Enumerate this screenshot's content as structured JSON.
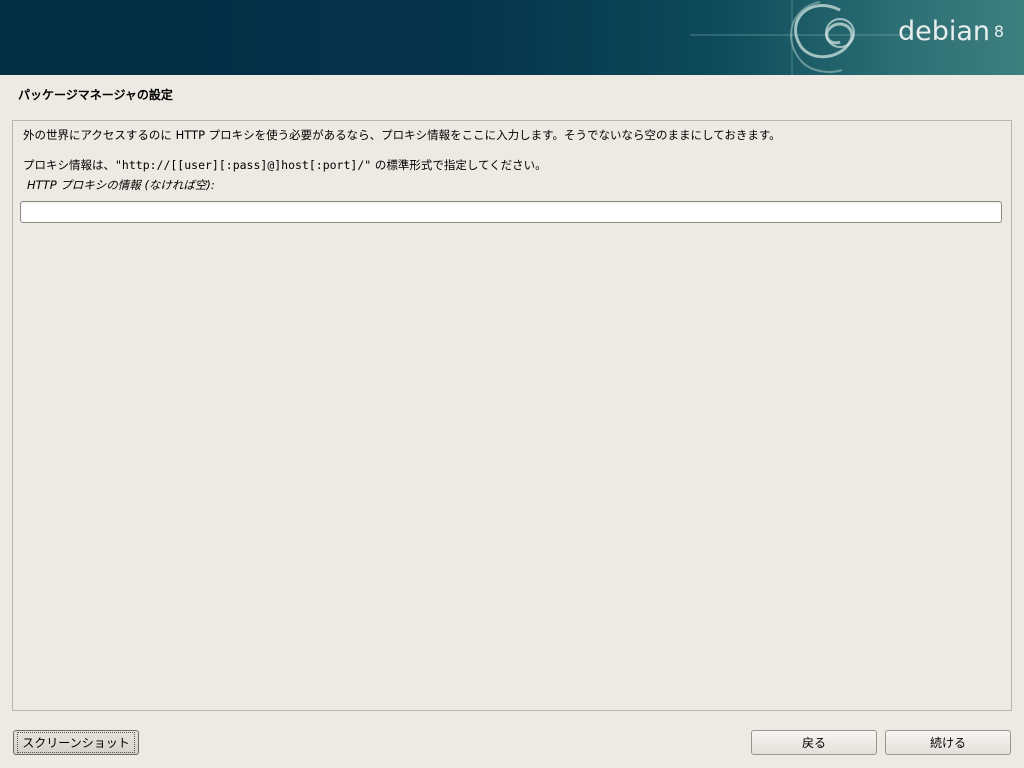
{
  "banner": {
    "logo_text": "debian",
    "version": "8",
    "colors": {
      "dark": "#042e44",
      "light": "#3e807f"
    }
  },
  "page": {
    "title": "パッケージマネージャの設定"
  },
  "panel": {
    "description_line1": "外の世界にアクセスするのに HTTP プロキシを使う必要があるなら、プロキシ情報をここに入力します。そうでないなら空のままにしておきます。",
    "description_line2_prefix": "プロキシ情報は、",
    "description_line2_format": "\"http://[[user][:pass]@]host[:port]/\"",
    "description_line2_suffix": " の標準形式で指定してください。",
    "field_label": "HTTP プロキシの情報 (なければ空):",
    "proxy_input_value": ""
  },
  "buttons": {
    "screenshot": "スクリーンショット",
    "back": "戻る",
    "continue": "続ける"
  }
}
